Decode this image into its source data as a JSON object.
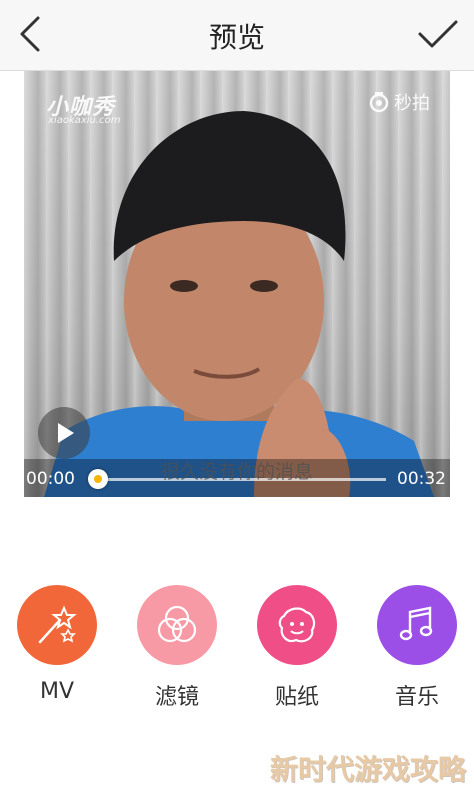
{
  "header": {
    "title": "预览",
    "back_icon": "chevron-left-icon",
    "confirm_icon": "checkmark-icon"
  },
  "video": {
    "watermark_logo": "小咖秀",
    "watermark_sub": "xiaokaxiu.com",
    "watermark_right": "秒拍",
    "subtitle": "很久没有你的消息",
    "current_time": "00:00",
    "duration": "00:32",
    "progress": 0.0
  },
  "tools": [
    {
      "label": "MV",
      "icon": "magic-wand-icon",
      "color": "#f2673a"
    },
    {
      "label": "滤镜",
      "icon": "filter-circles-icon",
      "color": "#f79aa5"
    },
    {
      "label": "贴纸",
      "icon": "sticker-icon",
      "color": "#ef4f86"
    },
    {
      "label": "音乐",
      "icon": "music-note-icon",
      "color": "#9b4fe6"
    }
  ],
  "watermark_corner": "新时代游戏攻略"
}
